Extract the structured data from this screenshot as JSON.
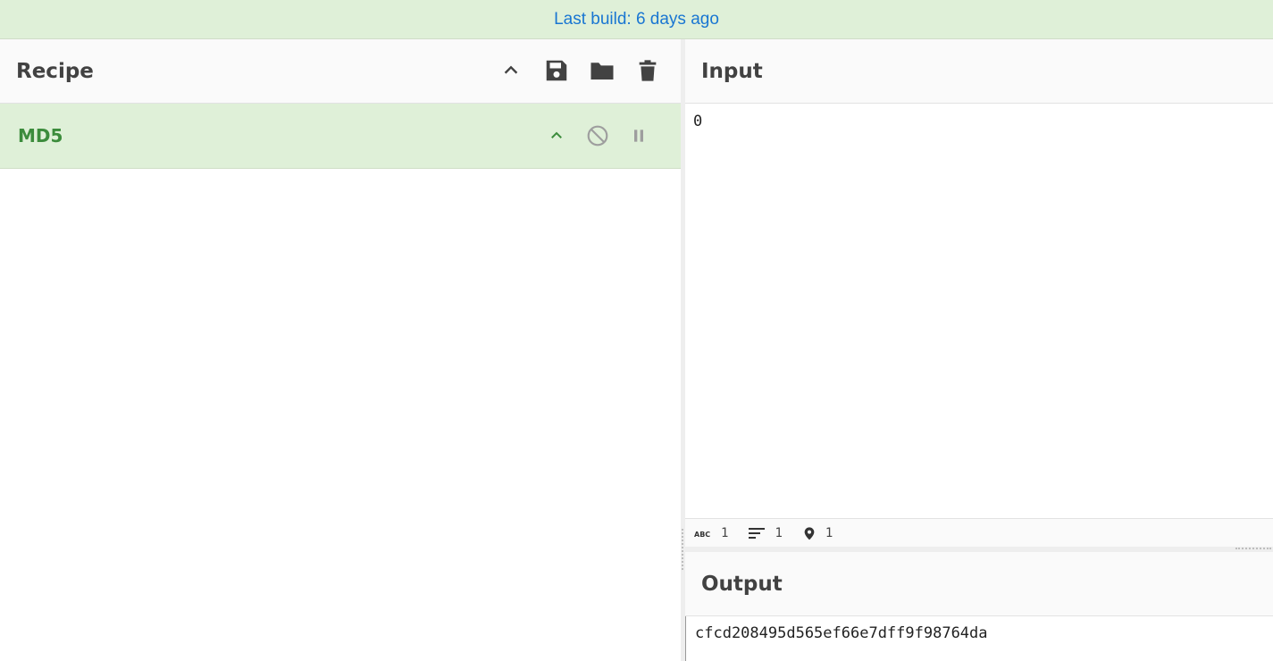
{
  "banner": {
    "text": "Last build: 6 days ago"
  },
  "recipe": {
    "title": "Recipe",
    "actions": [
      "collapse-all",
      "save",
      "load",
      "clear"
    ],
    "operations": [
      {
        "name": "MD5",
        "controls": [
          "collapse",
          "disable",
          "breakpoint"
        ]
      }
    ]
  },
  "input": {
    "title": "Input",
    "value": "0",
    "status": {
      "length": "1",
      "lines": "1",
      "position": "1"
    }
  },
  "output": {
    "title": "Output",
    "value": "cfcd208495d565ef66e7dff9f98764da"
  },
  "colors": {
    "banner_bg": "#dff0d8",
    "banner_text": "#1976d2",
    "operation_bg": "#dff0d8",
    "operation_text": "#3c8c3c"
  }
}
